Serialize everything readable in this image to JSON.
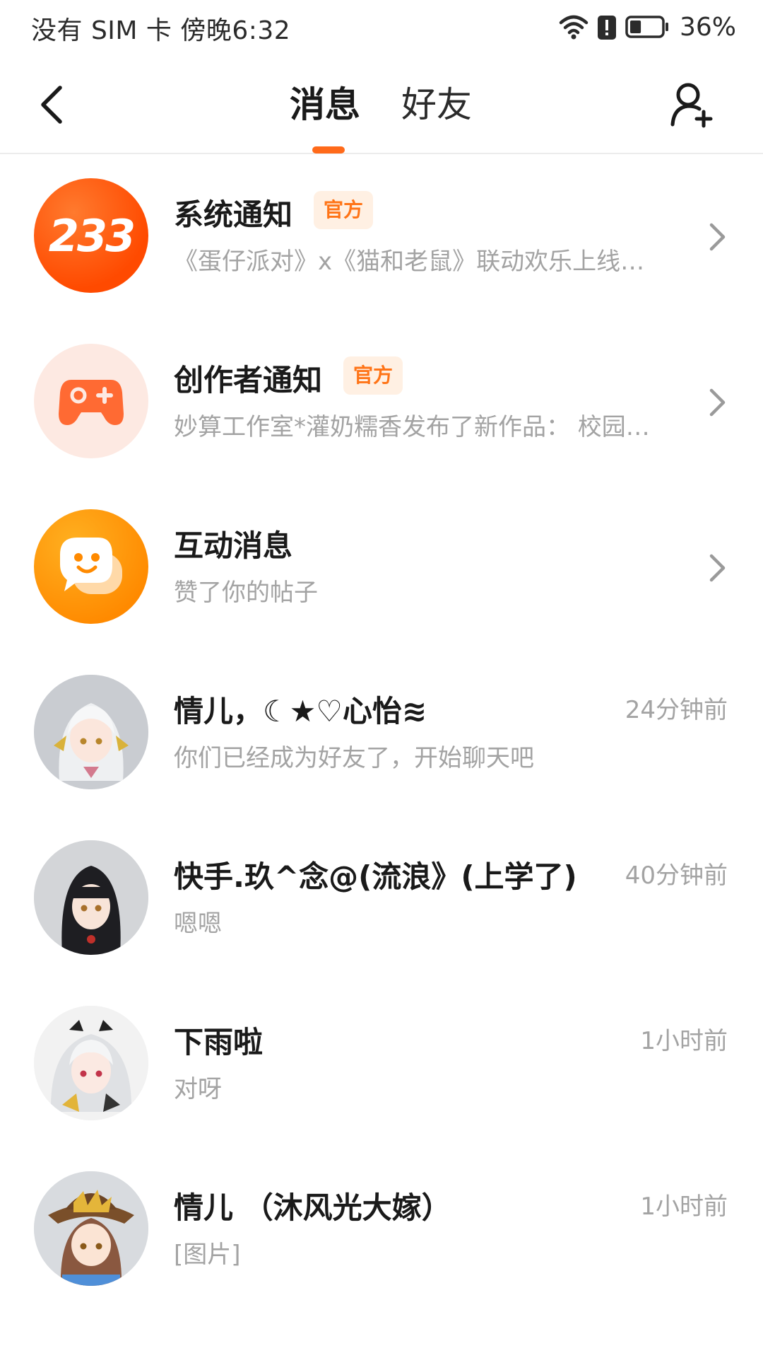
{
  "status_bar": {
    "left_text": "没有 SIM 卡 傍晚6:32",
    "battery_percent": "36%",
    "battery_level": 0.36
  },
  "header": {
    "tabs": [
      {
        "label": "消息",
        "active": true
      },
      {
        "label": "好友",
        "active": false
      }
    ],
    "accent_color": "#ff6a1a"
  },
  "messages": [
    {
      "type": "system",
      "title": "系统通知",
      "badge": "官方",
      "preview": "《蛋仔派对》x《猫和老鼠》联动欢乐上线…",
      "avatar_text": "233"
    },
    {
      "type": "creator",
      "title": "创作者通知",
      "badge": "官方",
      "preview": "妙算工作室*灌奶糯香发布了新作品： 校园…"
    },
    {
      "type": "interaction",
      "title": "互动消息",
      "preview": "赞了你的帖子"
    },
    {
      "type": "chat",
      "title": "情儿，☾★♡心怡≋",
      "preview": "你们已经成为好友了，开始聊天吧",
      "time": "24分钟前",
      "avatar_hint": "white-hair-girl"
    },
    {
      "type": "chat",
      "title": "快手.玖^念@(流浪》(上学了)",
      "preview": "嗯嗯",
      "time": "40分钟前",
      "avatar_hint": "black-hair-girl"
    },
    {
      "type": "chat",
      "title": "下雨啦",
      "preview": "对呀",
      "time": "1小时前",
      "avatar_hint": "silver-hair-girl"
    },
    {
      "type": "chat",
      "title": "情儿 （沐风光大嫁）",
      "preview": "[图片]",
      "time": "1小时前",
      "avatar_hint": "hat-girl"
    }
  ]
}
